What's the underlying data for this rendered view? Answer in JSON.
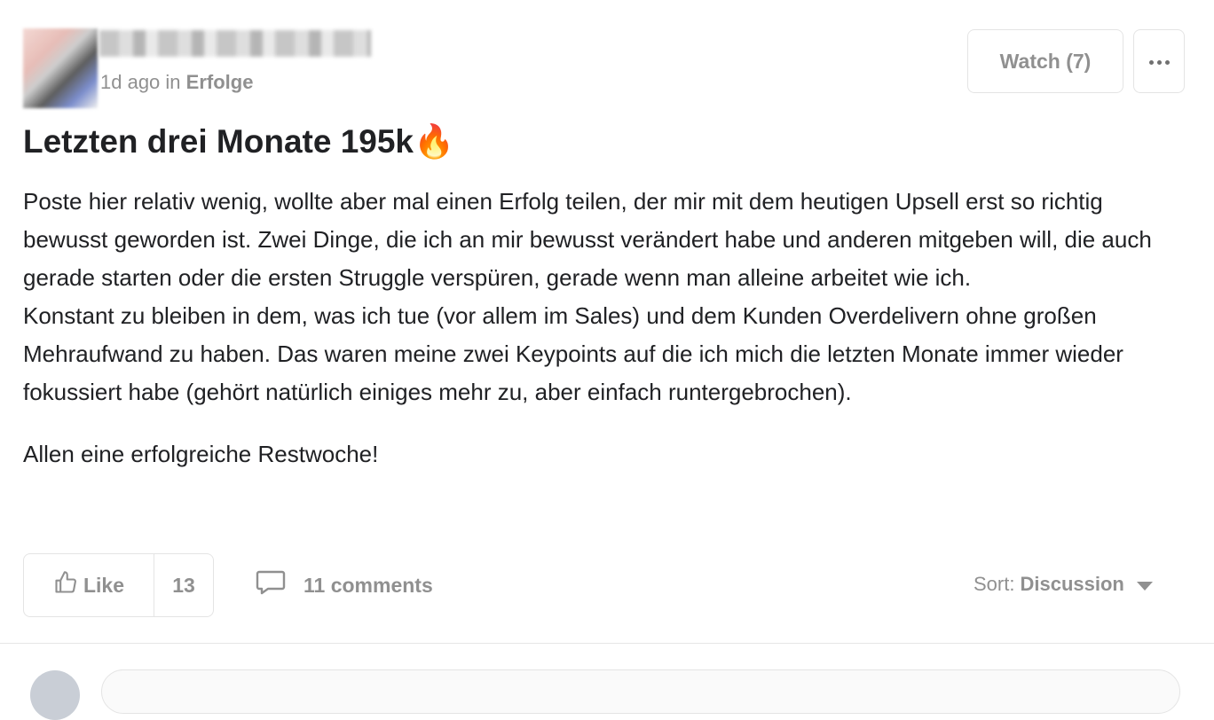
{
  "post": {
    "time_ago": "1d ago",
    "in_label": "in",
    "category": "Erfolge",
    "watch_label": "Watch (7)",
    "title": "Letzten drei Monate 195k🔥",
    "body_paragraphs": [
      "Poste hier relativ wenig, wollte aber mal einen Erfolg teilen, der mir mit dem heutigen Upsell erst so richtig bewusst geworden ist. Zwei Dinge, die ich an mir bewusst verändert habe und anderen mitgeben will, die auch gerade starten oder die ersten Struggle verspüren, gerade wenn man alleine arbeitet wie ich.",
      "Konstant zu bleiben in dem, was ich tue (vor allem im Sales) und dem Kunden Overdelivern ohne großen Mehraufwand zu haben. Das waren meine zwei Keypoints auf die ich mich die letzten Monate immer wieder fokussiert habe (gehört natürlich einiges mehr zu, aber einfach runtergebrochen).",
      "Allen eine erfolgreiche Restwoche!"
    ]
  },
  "actions": {
    "like_label": "Like",
    "like_count": "13",
    "comments_label": "11 comments",
    "sort_label": "Sort:",
    "sort_value": "Discussion"
  },
  "icons": {
    "like": "thumbs-up-icon",
    "comments": "speech-bubble-icon",
    "more": "ellipsis-icon",
    "sort": "caret-down-icon"
  },
  "colors": {
    "muted_text": "#909090",
    "border": "#e4e4e4",
    "title_text": "#202124"
  }
}
